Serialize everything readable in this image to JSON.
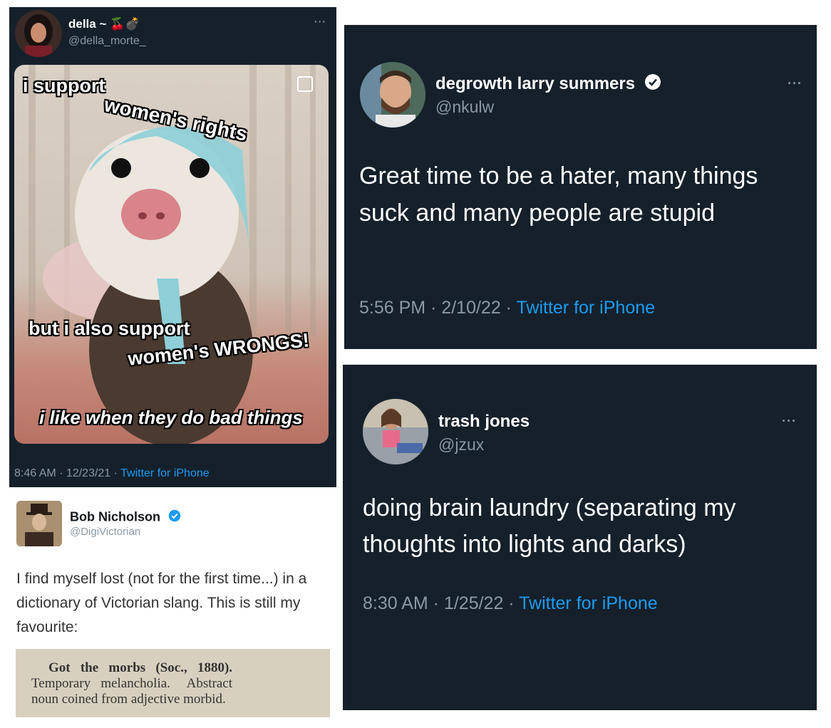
{
  "tweet_della": {
    "display_name": "della ~",
    "name_emoji": "🍒💣",
    "handle": "@della_morte_",
    "more_icon": "···",
    "meme": {
      "line1": "i support",
      "line2": "women's rights",
      "line3": "but i also support",
      "line4": "women's WRONGS!",
      "line5": "i like when they do bad things"
    },
    "time": "8:46 AM · 12/23/21 · ",
    "source": "Twitter for iPhone"
  },
  "tweet_nkulw": {
    "display_name": "degrowth larry summers",
    "handle": "@nkulw",
    "more_icon": "···",
    "text": "Great time to be a hater, many things suck and many people are stupid",
    "time": "5:56 PM · 2/10/22 · ",
    "source": "Twitter for iPhone"
  },
  "tweet_jzux": {
    "display_name": "trash jones",
    "handle": "@jzux",
    "more_icon": "···",
    "text": "doing brain laundry (separating my thoughts into lights and darks)",
    "time": "8:30 AM · 1/25/22 · ",
    "source": "Twitter for iPhone"
  },
  "tweet_bob": {
    "display_name": "Bob Nicholson",
    "handle": "@DigiVictorian",
    "text": "I find myself lost (not for the first time...) in a dictionary of Victorian slang. This is still my favourite:",
    "clipping": {
      "line1": "Got   the   morbs   (Soc.,   1880).",
      "line2": "Temporary   melancholia.     Abstract",
      "line3": "noun coined from adjective morbid."
    }
  },
  "colors": {
    "dark_bg": "#15202b",
    "accent": "#1d9bf0",
    "muted": "#8b98a5"
  }
}
